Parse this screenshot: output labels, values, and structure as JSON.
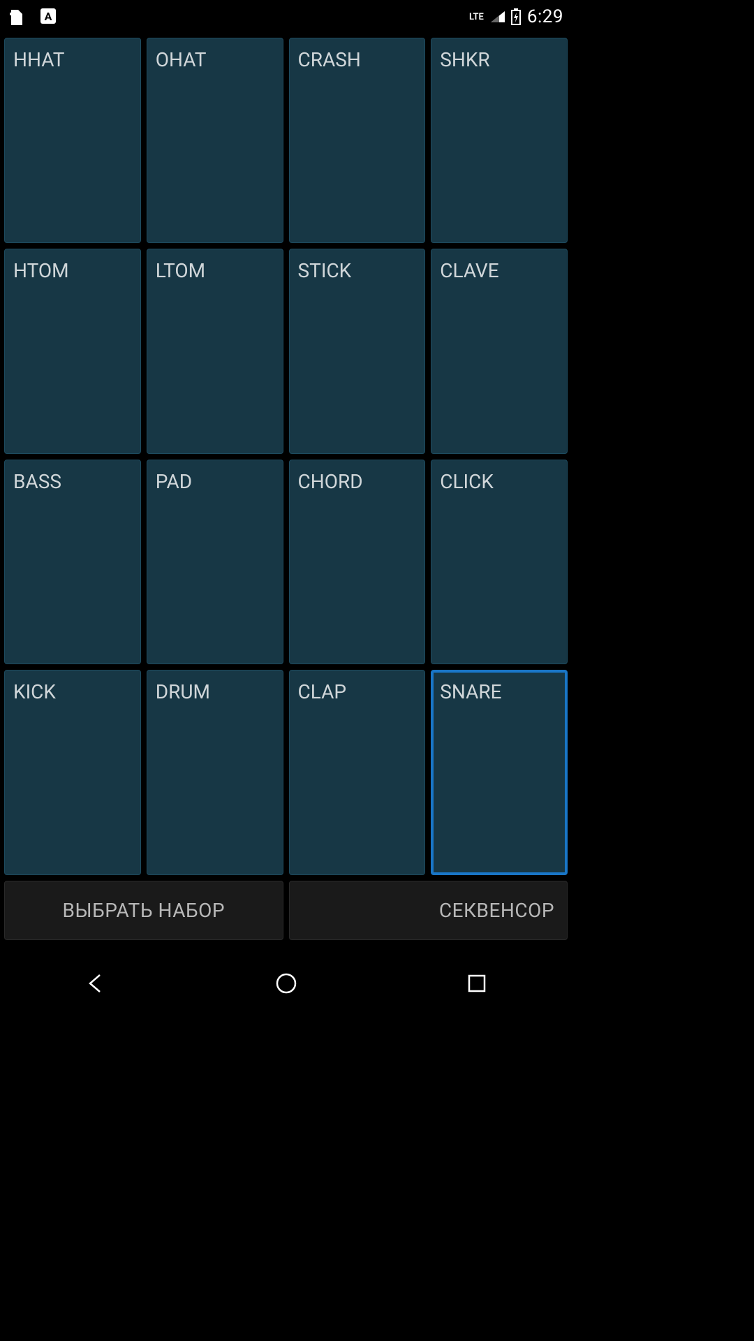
{
  "status": {
    "time": "6:29",
    "lte": "LTE"
  },
  "pads": [
    {
      "label": "HHAT",
      "selected": false
    },
    {
      "label": "OHAT",
      "selected": false
    },
    {
      "label": "CRASH",
      "selected": false
    },
    {
      "label": "SHKR",
      "selected": false
    },
    {
      "label": "HTOM",
      "selected": false
    },
    {
      "label": "LTOM",
      "selected": false
    },
    {
      "label": "STICK",
      "selected": false
    },
    {
      "label": "CLAVE",
      "selected": false
    },
    {
      "label": "BASS",
      "selected": false
    },
    {
      "label": "PAD",
      "selected": false
    },
    {
      "label": "CHORD",
      "selected": false
    },
    {
      "label": "CLICK",
      "selected": false
    },
    {
      "label": "KICK",
      "selected": false
    },
    {
      "label": "DRUM",
      "selected": false
    },
    {
      "label": "CLAP",
      "selected": false
    },
    {
      "label": "SNARE",
      "selected": true
    }
  ],
  "buttons": {
    "select_set": "ВЫБРАТЬ НАБОР",
    "sequencer": "СЕКВЕНСОР"
  }
}
